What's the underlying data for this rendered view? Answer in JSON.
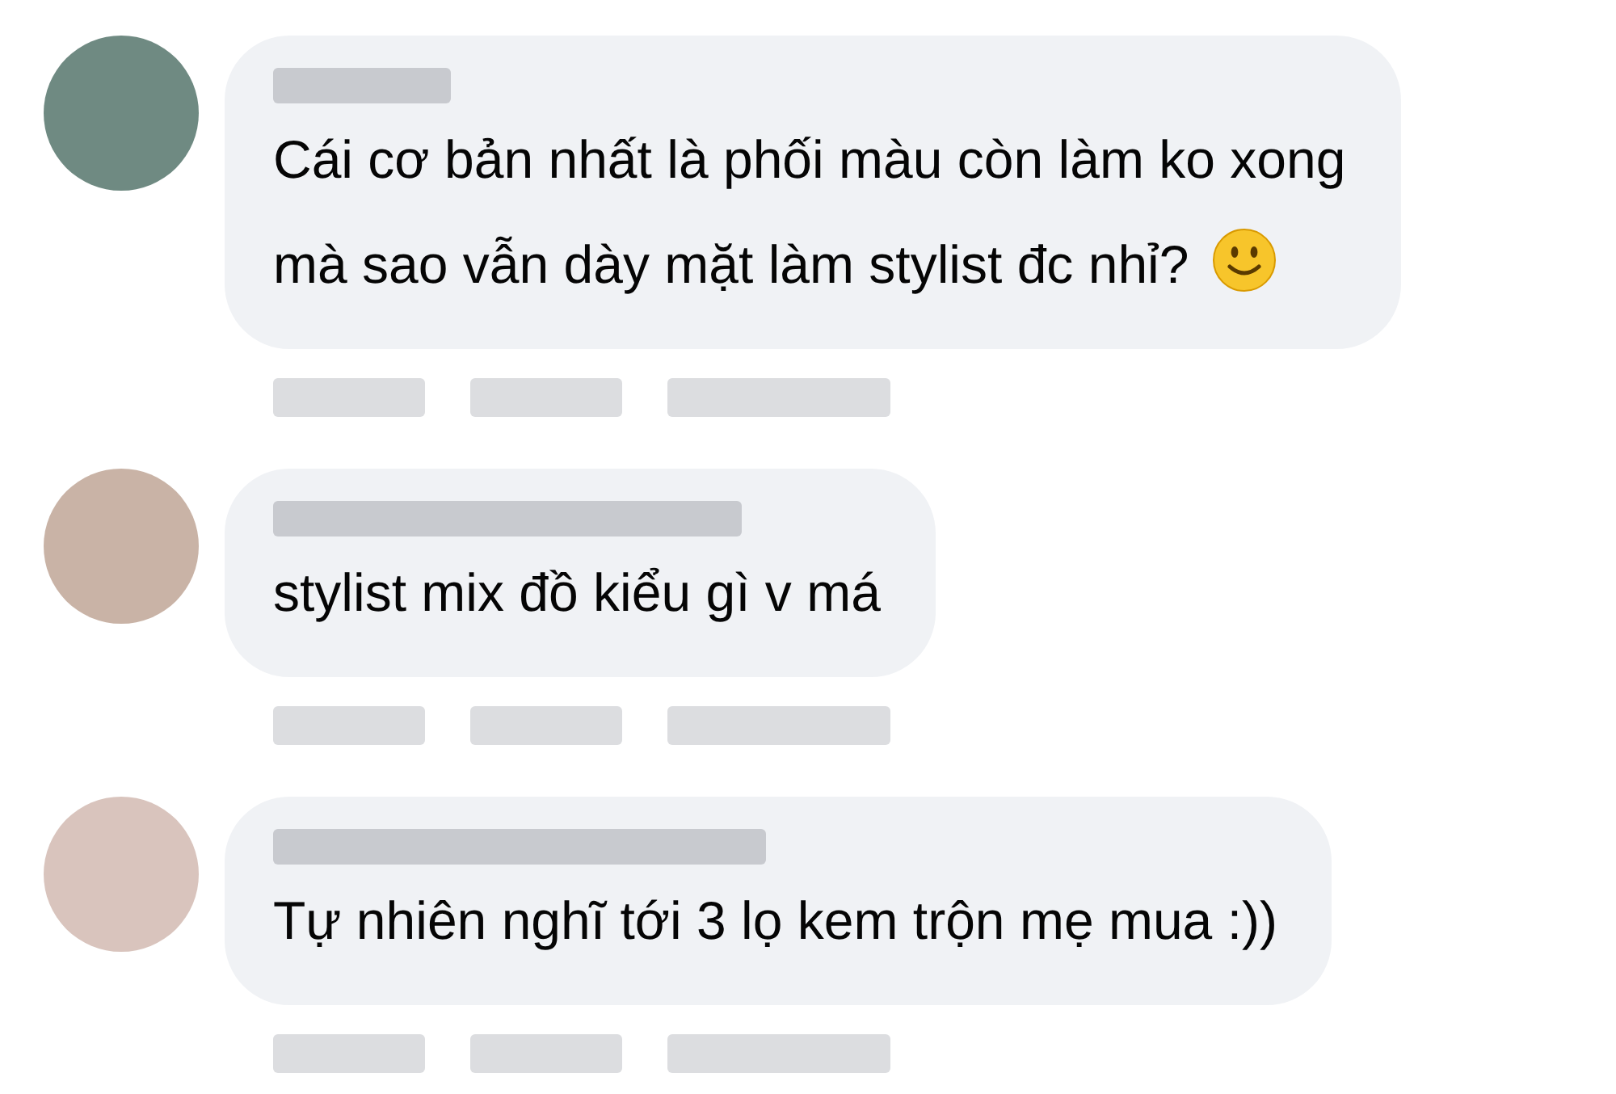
{
  "comments": [
    {
      "text": "Cái cơ bản nhất là phối màu còn làm ko xong\nmà sao vẫn dày mặt làm stylist đc nhỉ?",
      "smiley": true
    },
    {
      "text": "stylist mix đồ kiểu gì v má",
      "smiley": false
    },
    {
      "text": "Tự nhiên nghĩ tới 3 lọ kem trộn mẹ mua :))",
      "smiley": false
    }
  ]
}
